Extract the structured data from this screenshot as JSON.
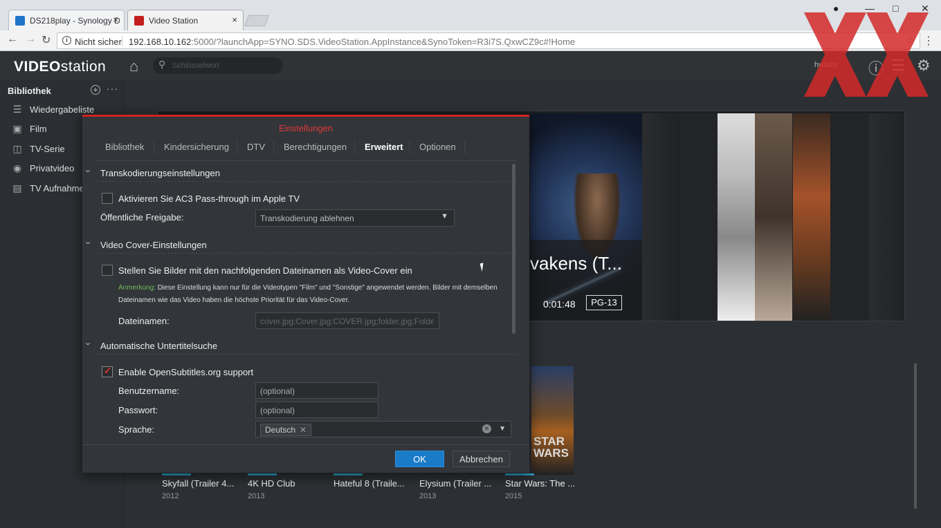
{
  "browser": {
    "tabs": [
      {
        "title": "DS218play - Synology D",
        "close": "×",
        "favicon_color": "#1e74c6"
      },
      {
        "title": "Video Station",
        "close": "×",
        "favicon_color": "#c41d1d"
      }
    ],
    "security_label": "Nicht sicher",
    "url_host": "192.168.10.162",
    "url_rest": ":5000/?launchApp=SYNO.SDS.VideoStation.AppInstance&SynoToken=R3i7S.QxwCZ9c#!Home",
    "nav_icons": [
      "back-icon",
      "forward-icon",
      "reload-icon"
    ],
    "window_controls": [
      "minimize",
      "maximize",
      "close"
    ]
  },
  "app": {
    "logo_prefix": "VIDEO",
    "logo_suffix": "station",
    "search_placeholder": "Schlüsselwort",
    "user": "hwluxx",
    "accent": "#d42222"
  },
  "sidebar": {
    "header": "Bibliothek",
    "items": [
      {
        "label": "Wiedergabeliste",
        "icon": "playlist-icon"
      },
      {
        "label": "Film",
        "icon": "film-icon"
      },
      {
        "label": "TV-Serie",
        "icon": "tv-icon"
      },
      {
        "label": "Privatvideo",
        "icon": "camera-icon"
      },
      {
        "label": "TV Aufnahme",
        "icon": "dvr-icon"
      }
    ]
  },
  "hero": {
    "title": "vakens (T...",
    "runtime": "0:01:48",
    "rating": "PG-13"
  },
  "thumbnails": [
    {
      "title": "Skyfall (Trailer 4...",
      "year": "2012"
    },
    {
      "title": "4K HD Club",
      "year": "2013"
    },
    {
      "title": "Hateful 8 (Traile...",
      "year": ""
    },
    {
      "title": "Elysium (Trailer ...",
      "year": "2013"
    },
    {
      "title": "Star Wars: The ...",
      "year": "2015"
    }
  ],
  "poster_text": {
    "star": "STAR",
    "wars": "WARS"
  },
  "dialog": {
    "title": "Einstellungen",
    "tabs": [
      "Bibliothek",
      "Kindersicherung",
      "DTV",
      "Berechtigungen",
      "Erweitert",
      "Optionen"
    ],
    "active_tab": "Erweitert",
    "sections": {
      "transcoding": {
        "title": "Transkodierungseinstellungen",
        "ac3_label": "Aktivieren Sie AC3 Pass-through im Apple TV",
        "ac3_checked": false,
        "public_share_label": "Öffentliche Freigabe:",
        "public_share_value": "Transkodierung ablehnen"
      },
      "cover": {
        "title": "Video Cover-Einstellungen",
        "use_images_label": "Stellen Sie Bilder mit den nachfolgenden Dateinamen als Video-Cover ein",
        "use_images_checked": false,
        "note_prefix": "Anmerkung:",
        "note_text": "Diese Einstellung kann nur für die Videotypen \"Film\" und \"Sonstige\" angewendet werden. Bilder mit demselben Dateinamen wie das Video haben die höchste Priorität für das Video-Cover.",
        "filenames_label": "Dateinamen:",
        "filenames_placeholder": "cover.jpg;Cover.jpg;COVER.jpg;folder.jpg;Folder.jpg"
      },
      "subtitles": {
        "title": "Automatische Untertitelsuche",
        "enable_label": "Enable OpenSubtitles.org support",
        "enable_checked": true,
        "username_label": "Benutzername:",
        "username_placeholder": "(optional)",
        "password_label": "Passwort:",
        "password_placeholder": "(optional)",
        "language_label": "Sprache:",
        "language_value": "Deutsch"
      }
    },
    "ok_label": "OK",
    "cancel_label": "Abbrechen"
  }
}
